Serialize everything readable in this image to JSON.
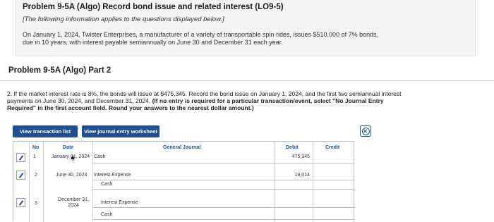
{
  "header": {
    "title": "Problem 9-5A (Algo) Record bond issue and related interest (LO9-5)",
    "note": "[The following information applies to the questions displayed below.]",
    "intro": "On January 1, 2024, Twister Enterprises, a manufacturer of a variety of transportable spin rides, issues $510,000 of 7% bonds, due in 10 years, with interest payable semiannually on June 30 and December 31 each year."
  },
  "part": {
    "title": "Problem 9-5A (Algo) Part 2"
  },
  "question": {
    "text": "2. If the market interest rate is 8%, the bonds will issue at $475,345. Record the bond issue on January 1, 2024, and the first two semiannual interest payments on June 30, 2024, and December 31, 2024.",
    "bold": " (If no entry is required for a particular transaction/event, select \"No Journal Entry Required\" in the first account field. Round your answers to the nearest dollar amount.)"
  },
  "buttons": {
    "view_list": "View transaction list",
    "view_worksheet": "View journal entry worksheet"
  },
  "icons": {
    "close": "close-circle-icon",
    "edit": "pencil-icon",
    "cursor": "mouse-pointer-icon"
  },
  "table": {
    "headers": {
      "no": "No",
      "date": "Date",
      "general_journal": "General Journal",
      "debit": "Debit",
      "credit": "Credit"
    },
    "rows": [
      {
        "no": "1",
        "date": "January 01, 2024",
        "lines": [
          {
            "account": "Cash",
            "debit": "475,345",
            "credit": ""
          }
        ]
      },
      {
        "no": "2",
        "date": "June 30, 2024",
        "lines": [
          {
            "account": "Interest Expense",
            "debit": "19,014",
            "credit": ""
          },
          {
            "account": "Cash",
            "debit": "",
            "credit": ""
          }
        ]
      },
      {
        "no": "3",
        "date": "December 31, 2024",
        "lines": [
          {
            "account": "Interest Expense",
            "debit": "",
            "credit": ""
          },
          {
            "account": "Cash",
            "debit": "",
            "credit": ""
          }
        ]
      }
    ]
  },
  "colors": {
    "accent": "#1f4f93",
    "intro_bg": "#f4f4f4"
  }
}
